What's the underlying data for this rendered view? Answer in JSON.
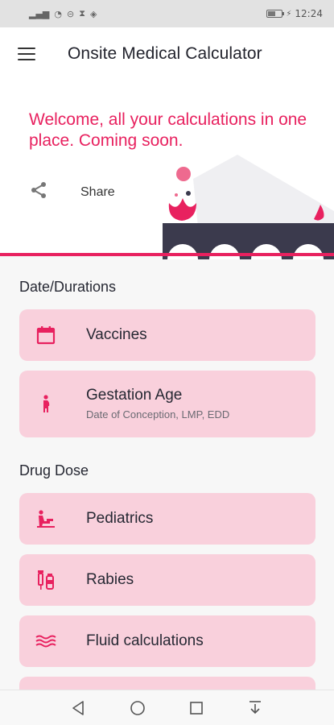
{
  "status_bar": {
    "time": "12:24",
    "battery_level_percent": 55,
    "left_icons": [
      "signal-icon",
      "wifi-icon",
      "data-saver-icon",
      "hourglass-icon",
      "location-icon"
    ]
  },
  "header": {
    "title": "Onsite Medical Calculator",
    "welcome_text": "Welcome, all your calculations in one place. Coming soon.",
    "share_label": "Share"
  },
  "sections": [
    {
      "title": "Date/Durations",
      "items": [
        {
          "label": "Vaccines",
          "subtitle": "",
          "icon": "calendar-icon"
        },
        {
          "label": "Gestation Age",
          "subtitle": "Date of Conception, LMP, EDD",
          "icon": "pregnant-person-icon"
        }
      ]
    },
    {
      "title": "Drug Dose",
      "items": [
        {
          "label": "Pediatrics",
          "subtitle": "",
          "icon": "child-care-icon"
        },
        {
          "label": "Rabies",
          "subtitle": "",
          "icon": "vaccine-syringe-icon"
        },
        {
          "label": "Fluid calculations",
          "subtitle": "",
          "icon": "waves-icon"
        }
      ]
    }
  ],
  "navbar": {
    "buttons": [
      "back-icon",
      "home-icon",
      "recents-icon",
      "notification-pull-icon"
    ]
  },
  "colors": {
    "accent": "#e8215f",
    "card_bg": "#f9d0dc",
    "illustration_dark": "#3b3a4d"
  }
}
